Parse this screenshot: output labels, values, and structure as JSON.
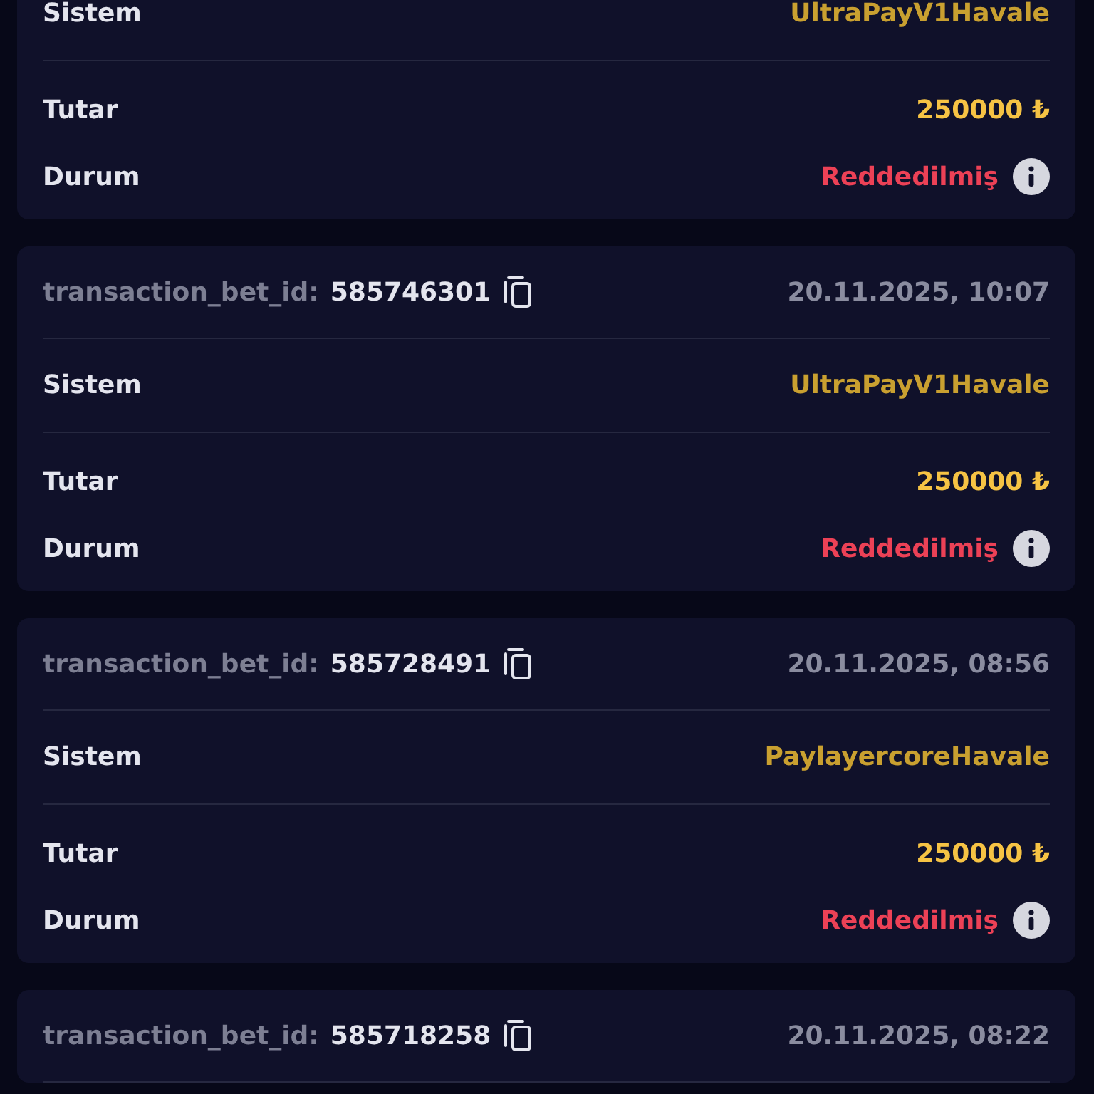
{
  "transactions": [
    {
      "system_label": "Sistem",
      "system": "UltraPayV1Havale",
      "amount_label": "Tutar",
      "amount": "250000 ₺",
      "status_label": "Durum",
      "status": "Reddedilmiş"
    },
    {
      "id_label": "transaction_bet_id:",
      "id": "585746301",
      "date": "20.11.2025, 10:07",
      "system_label": "Sistem",
      "system": "UltraPayV1Havale",
      "amount_label": "Tutar",
      "amount": "250000 ₺",
      "status_label": "Durum",
      "status": "Reddedilmiş"
    },
    {
      "id_label": "transaction_bet_id:",
      "id": "585728491",
      "date": "20.11.2025, 08:56",
      "system_label": "Sistem",
      "system": "PaylayercoreHavale",
      "amount_label": "Tutar",
      "amount": "250000 ₺",
      "status_label": "Durum",
      "status": "Reddedilmiş"
    },
    {
      "id_label": "transaction_bet_id:",
      "id": "585718258",
      "date": "20.11.2025, 08:22"
    }
  ]
}
